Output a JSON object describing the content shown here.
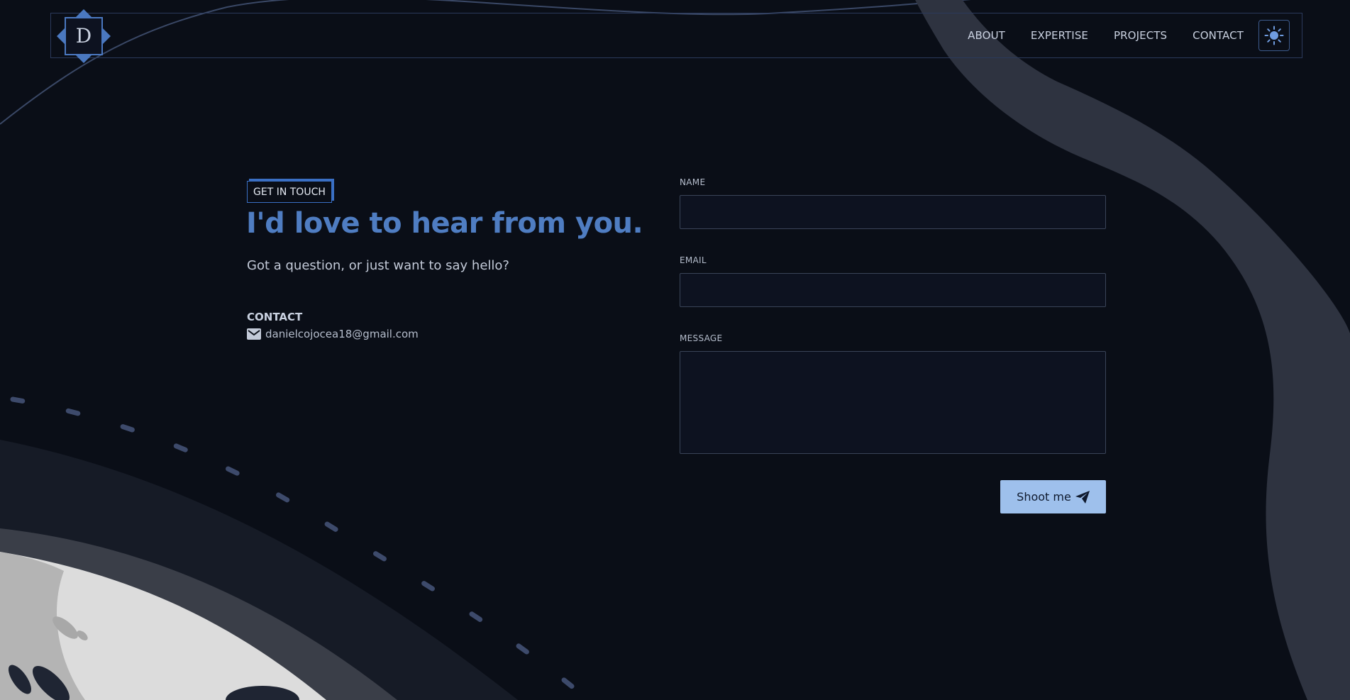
{
  "header": {
    "logo_letter": "D",
    "nav": [
      {
        "label": "ABOUT"
      },
      {
        "label": "EXPERTISE"
      },
      {
        "label": "PROJECTS"
      },
      {
        "label": "CONTACT"
      }
    ],
    "theme_toggle_icon": "sun-icon"
  },
  "intro": {
    "tag": "GET IN TOUCH",
    "headline": "I'd love to hear from you.",
    "subtitle": "Got a question, or just want to say hello?",
    "contact_label": "CONTACT",
    "email": "danielcojocea18@gmail.com",
    "email_icon": "mail-icon"
  },
  "form": {
    "name_label": "NAME",
    "name_value": "",
    "email_label": "EMAIL",
    "email_value": "",
    "message_label": "MESSAGE",
    "message_value": "",
    "submit_label": "Shoot me",
    "submit_icon": "paper-plane-icon"
  },
  "colors": {
    "background": "#0a0e17",
    "accent": "#4f7dc2",
    "button": "#9ec0ec",
    "border": "#2b3a5c"
  }
}
